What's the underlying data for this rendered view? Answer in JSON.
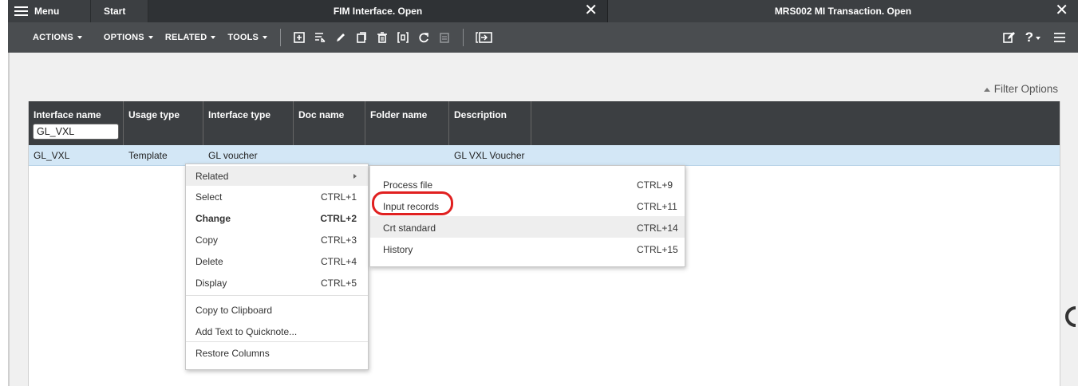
{
  "tabs": {
    "menu_label": "Menu",
    "start_label": "Start",
    "active_title": "FIM Interface. Open",
    "second_title": "MRS002 MI Transaction. Open",
    "close_glyph": "✕"
  },
  "toolbar": {
    "actions": "ACTIONS",
    "options": "OPTIONS",
    "related": "RELATED",
    "tools": "TOOLS",
    "icons": [
      "add-icon",
      "select-icon",
      "edit-icon",
      "copy-icon",
      "delete-icon",
      "display-icon",
      "refresh-icon",
      "disabled-icon",
      "panel-icon"
    ],
    "right_icons": [
      "edit-note-icon",
      "help-icon",
      "hamburger-icon"
    ],
    "help_label": "?"
  },
  "filter_options": "Filter Options",
  "grid": {
    "columns": [
      "Interface name",
      "Usage type",
      "Interface type",
      "Doc name",
      "Folder name",
      "Description"
    ],
    "filter_value": "GL_VXL",
    "rows": [
      {
        "interface_name": "GL_VXL",
        "usage_type": "Template",
        "interface_type": "GL voucher",
        "doc_name": "",
        "folder_name": "",
        "description": "GL VXL Voucher"
      }
    ]
  },
  "context_menu": {
    "items": [
      {
        "label": "Related",
        "shortcut": ""
      },
      {
        "label": "Select",
        "shortcut": "CTRL+1"
      },
      {
        "label": "Change",
        "shortcut": "CTRL+2"
      },
      {
        "label": "Copy",
        "shortcut": "CTRL+3"
      },
      {
        "label": "Delete",
        "shortcut": "CTRL+4"
      },
      {
        "label": "Display",
        "shortcut": "CTRL+5"
      },
      {
        "label": "Copy to Clipboard",
        "shortcut": ""
      },
      {
        "label": "Add Text to Quicknote...",
        "shortcut": ""
      },
      {
        "label": "Restore Columns",
        "shortcut": ""
      }
    ]
  },
  "sub_menu": {
    "items": [
      {
        "label": "Process file",
        "shortcut": "CTRL+9"
      },
      {
        "label": "Input records",
        "shortcut": "CTRL+11"
      },
      {
        "label": "Crt standard",
        "shortcut": "CTRL+14"
      },
      {
        "label": "History",
        "shortcut": "CTRL+15"
      }
    ]
  },
  "colors": {
    "tabbar": "#3c3f42",
    "toolbar": "#4a4d50",
    "selected_row": "#d3e7f6",
    "annotation": "#e02020"
  }
}
